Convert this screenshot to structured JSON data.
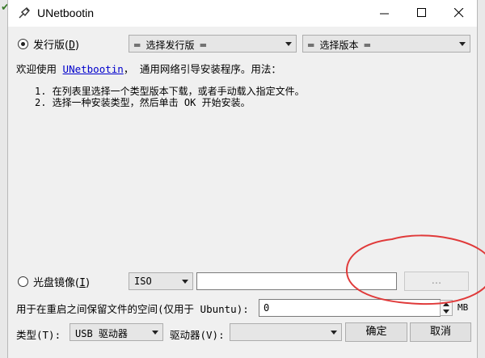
{
  "window": {
    "title": "UNetbootin"
  },
  "distribution": {
    "radio_label": "发行版(",
    "radio_key": "D",
    "radio_tail": ")",
    "selected": true,
    "distro_select": "═ 选择发行版 ═",
    "version_select": "═ 选择版本 ═"
  },
  "description": {
    "intro_before": "欢迎使用",
    "link_text": "UNetbootin",
    "intro_after": "， 通用网络引导安装程序。用法：",
    "steps": [
      "1. 在列表里选择一个类型版本下载，或者手动载入指定文件。",
      "2. 选择一种安装类型，然后单击 OK 开始安装。"
    ]
  },
  "disk_image": {
    "radio_label": "光盘镜像(",
    "radio_key": "I",
    "radio_tail": ")",
    "selected": false,
    "format": "ISO",
    "path_value": "",
    "browse_label": "..."
  },
  "persistence": {
    "label": "用于在重启之间保留文件的空间(仅用于 Ubuntu):",
    "value": "0",
    "unit": "MB"
  },
  "install": {
    "type_label": "类型(T):",
    "type_value": "USB 驱动器",
    "drive_label": "驱动器(V):",
    "drive_value": "",
    "ok_label": "确定",
    "cancel_label": "取消"
  },
  "annotation_color": "#e03a3a"
}
